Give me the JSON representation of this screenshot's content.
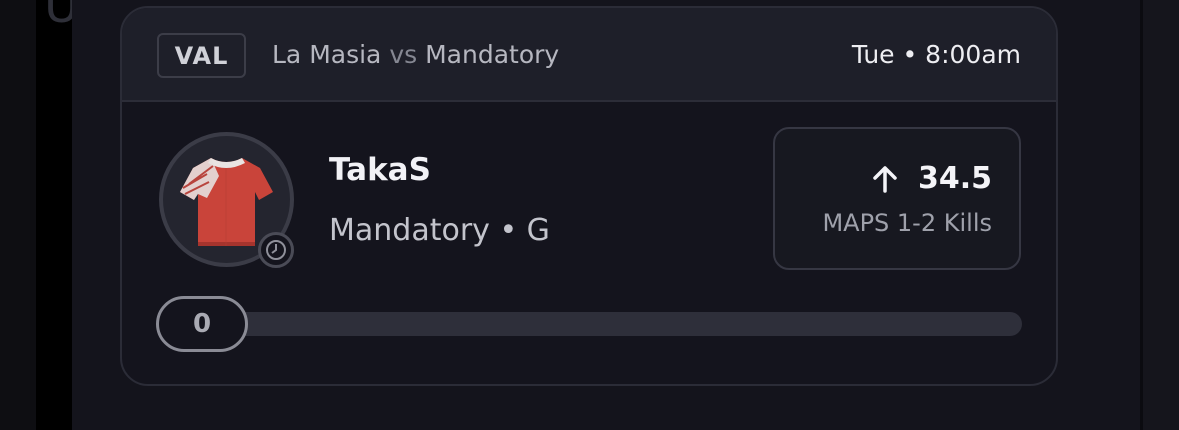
{
  "background": {
    "partial_letter": "U"
  },
  "card": {
    "league": "VAL",
    "team_a": "La Masia",
    "vs": "vs",
    "team_b": "Mandatory",
    "time": "Tue • 8:00am"
  },
  "player": {
    "name": "TakaS",
    "team_position": "Mandatory • G",
    "avatar_icon": "jersey-icon",
    "status_icon": "clock-icon"
  },
  "projection": {
    "direction_icon": "arrow-up-icon",
    "value": "34.5",
    "label": "MAPS 1-2 Kills"
  },
  "progress": {
    "current": "0"
  },
  "colors": {
    "jersey_red": "#c9443a",
    "card_bg": "#14141d",
    "header_bg": "#1e1f29"
  }
}
